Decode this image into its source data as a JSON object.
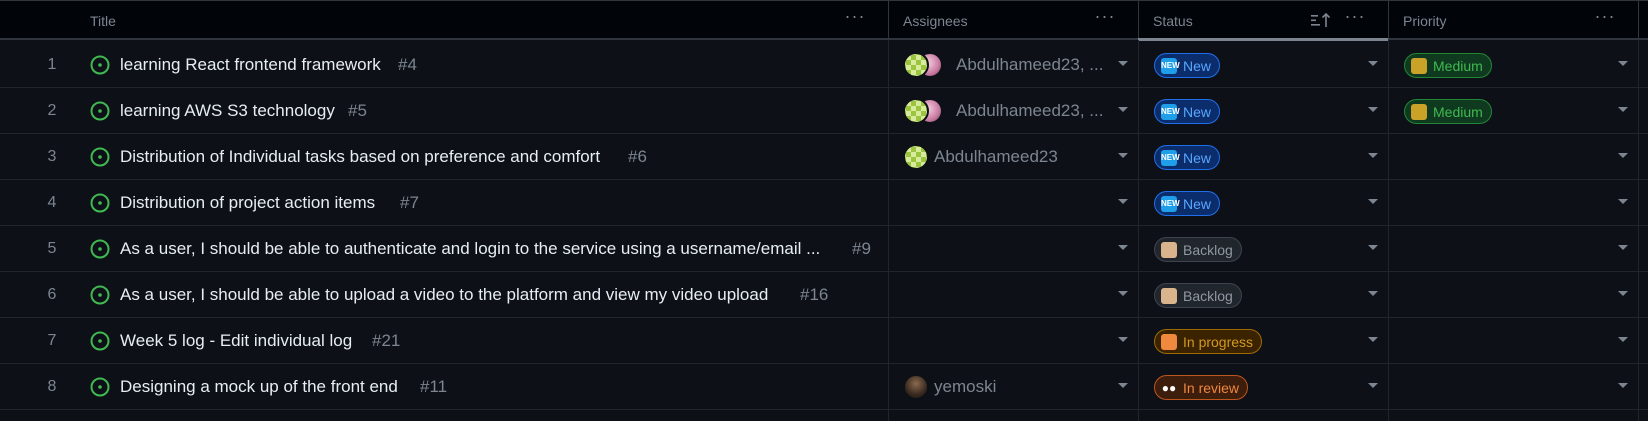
{
  "columns": {
    "title": "Title",
    "assignees": "Assignees",
    "status": "Status",
    "priority": "Priority"
  },
  "icons": {
    "column_menu": "ellipsis-icon",
    "sort": "sort-ascending-icon",
    "issue": "issue-opened-icon",
    "dropdown": "triangle-down-icon"
  },
  "rows": [
    {
      "n": "1",
      "title": "learning React frontend framework",
      "num": "#4",
      "assignees": "Abdulhameed23, ...",
      "status": "New",
      "priority": "Medium"
    },
    {
      "n": "2",
      "title": "learning AWS S3 technology",
      "num": "#5",
      "assignees": "Abdulhameed23, ...",
      "status": "New",
      "priority": "Medium"
    },
    {
      "n": "3",
      "title": "Distribution of Individual tasks based on preference and comfort",
      "num": "#6",
      "assignees": "Abdulhameed23",
      "status": "New",
      "priority": ""
    },
    {
      "n": "4",
      "title": "Distribution of project action items",
      "num": "#7",
      "assignees": "",
      "status": "New",
      "priority": ""
    },
    {
      "n": "5",
      "title": "As a user, I should be able to authenticate and login to the service using a username/email ...",
      "num": "#9",
      "assignees": "",
      "status": "Backlog",
      "priority": ""
    },
    {
      "n": "6",
      "title": "As a user, I should be able to upload a video to the platform and view my video upload",
      "num": "#16",
      "assignees": "",
      "status": "Backlog",
      "priority": ""
    },
    {
      "n": "7",
      "title": "Week 5 log - Edit individual log",
      "num": "#21",
      "assignees": "",
      "status": "In progress",
      "priority": ""
    },
    {
      "n": "8",
      "title": "Designing a mock up of the front end",
      "num": "#11",
      "assignees": "yemoski",
      "status": "In review",
      "priority": ""
    }
  ]
}
